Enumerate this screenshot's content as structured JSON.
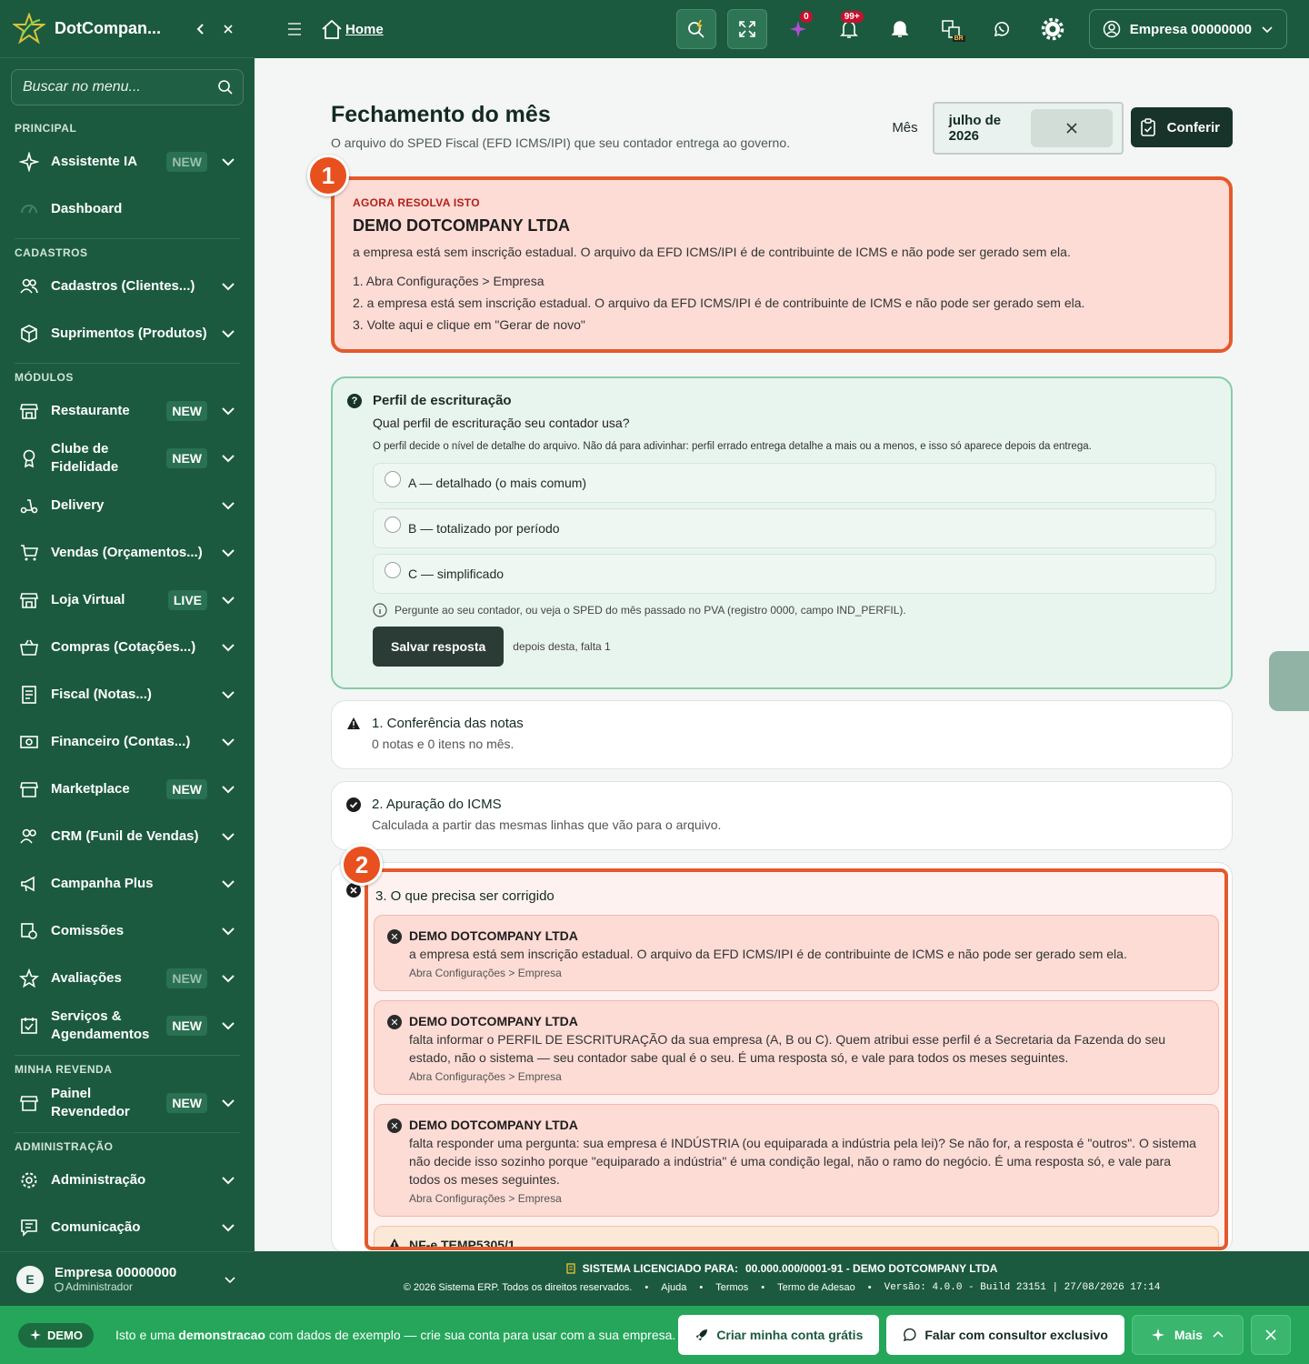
{
  "app": {
    "brand": "DotCompan..."
  },
  "sidebar": {
    "search_placeholder": "Buscar no menu...",
    "sections": {
      "principal": "PRINCIPAL",
      "cadastros": "CADASTROS",
      "modulos": "MÓDULOS",
      "revenda": "MINHA REVENDA",
      "admin": "ADMINISTRAÇÃO"
    },
    "items": [
      {
        "label": "Assistente IA",
        "badge": "NEW"
      },
      {
        "label": "Dashboard"
      },
      {
        "label": "Cadastros (Clientes...)"
      },
      {
        "label": "Suprimentos (Produtos)"
      },
      {
        "label": "Restaurante",
        "badge": "NEW"
      },
      {
        "label": "Clube de Fidelidade",
        "badge": "NEW"
      },
      {
        "label": "Delivery"
      },
      {
        "label": "Vendas (Orçamentos...)"
      },
      {
        "label": "Loja Virtual",
        "badge": "LIVE"
      },
      {
        "label": "Compras (Cotações...)"
      },
      {
        "label": "Fiscal (Notas...)"
      },
      {
        "label": "Financeiro (Contas...)"
      },
      {
        "label": "Marketplace",
        "badge": "NEW"
      },
      {
        "label": "CRM (Funil de Vendas)"
      },
      {
        "label": "Campanha Plus"
      },
      {
        "label": "Comissões"
      },
      {
        "label": "Avaliações",
        "badge": "NEW"
      },
      {
        "label": "Serviços & Agendamentos",
        "badge": "NEW"
      },
      {
        "label": "Painel Revendedor",
        "badge": "NEW"
      },
      {
        "label": "Administração"
      },
      {
        "label": "Comunicação"
      }
    ],
    "user": {
      "initial": "E",
      "name": "Empresa 00000000",
      "role": "Administrador"
    }
  },
  "topbar": {
    "home": "Home",
    "badges": {
      "sparkle": "0",
      "bell": "99+"
    },
    "lang": "BR",
    "account": "Empresa 00000000"
  },
  "page": {
    "title": "Fechamento do mês",
    "subtitle": "O arquivo do SPED Fiscal (EFD ICMS/IPI) que seu contador entrega ao governo.",
    "month_label": "Mês",
    "month_value": "julho de 2026",
    "conferir": "Conferir"
  },
  "markers": {
    "one": "1",
    "two": "2"
  },
  "alert": {
    "tag": "AGORA RESOLVA ISTO",
    "title": "DEMO DOTCOMPANY LTDA",
    "desc": "a empresa está sem inscrição estadual. O arquivo da EFD ICMS/IPI é de contribuinte de ICMS e não pode ser gerado sem ela.",
    "steps": [
      "1. Abra Configurações > Empresa",
      "2. a empresa está sem inscrição estadual. O arquivo da EFD ICMS/IPI é de contribuinte de ICMS e não pode ser gerado sem ela.",
      "3. Volte aqui e clique em \"Gerar de novo\""
    ]
  },
  "perfil": {
    "title": "Perfil de escrituração",
    "question": "Qual perfil de escrituração seu contador usa?",
    "note": "O perfil decide o nível de detalhe do arquivo. Não dá para adivinhar: perfil errado entrega detalhe a mais ou a menos, e isso só aparece depois da entrega.",
    "options": [
      "A — detalhado (o mais comum)",
      "B — totalizado por período",
      "C — simplificado"
    ],
    "hint": "Pergunte ao seu contador, ou veja o SPED do mês passado no PVA (registro 0000, campo IND_PERFIL).",
    "save": "Salvar resposta",
    "save_note": "depois desta, falta 1"
  },
  "steps": [
    {
      "title": "1. Conferência das notas",
      "sub": "0 notas e 0 itens no mês."
    },
    {
      "title": "2. Apuração do ICMS",
      "sub": "Calculada a partir das mesmas linhas que vão para o arquivo."
    },
    {
      "title": "3. O que precisa ser corrigido"
    }
  ],
  "errors": [
    {
      "title": "DEMO DOTCOMPANY LTDA",
      "desc": "a empresa está sem inscrição estadual. O arquivo da EFD ICMS/IPI é de contribuinte de ICMS e não pode ser gerado sem ela.",
      "hint": "Abra Configurações > Empresa"
    },
    {
      "title": "DEMO DOTCOMPANY LTDA",
      "desc": "falta informar o PERFIL DE ESCRITURAÇÃO da sua empresa (A, B ou C). Quem atribui esse perfil é a Secretaria da Fazenda do seu estado, não o sistema — seu contador sabe qual é o seu. É uma resposta só, e vale para todos os meses seguintes.",
      "hint": "Abra Configurações > Empresa"
    },
    {
      "title": "DEMO DOTCOMPANY LTDA",
      "desc": "falta responder uma pergunta: sua empresa é INDÚSTRIA (ou equiparada a indústria pela lei)? Se não for, a resposta é \"outros\". O sistema não decide isso sozinho porque \"equiparado a indústria\" é uma condição legal, não o ramo do negócio. É uma resposta só, e vale para todos os meses seguintes.",
      "hint": "Abra Configurações > Empresa"
    }
  ],
  "warning": {
    "title": "NF-e TEMP5305/1"
  },
  "footer": {
    "license_label": "SISTEMA LICENCIADO PARA:",
    "license_value": "00.000.000/0001-91 - DEMO DOTCOMPANY LTDA",
    "copyright": "© 2026 Sistema ERP. Todos os direitos reservados.",
    "links": [
      "Ajuda",
      "Termos",
      "Termo de Adesao"
    ],
    "version": "Versão: 4.0.0 - Build 23151 | 27/08/2026 17:14"
  },
  "demo": {
    "pill": "DEMO",
    "text_a": "Isto e uma ",
    "text_b": "demonstracao",
    "text_c": " com dados de exemplo — crie sua conta para usar com a sua empresa.",
    "create": "Criar minha conta grátis",
    "consult": "Falar com consultor exclusivo",
    "more": "Mais"
  },
  "colors": {
    "sidebar": "#1b5a3f",
    "accent": "#e35a2c",
    "demo_bar": "#25a65a"
  }
}
